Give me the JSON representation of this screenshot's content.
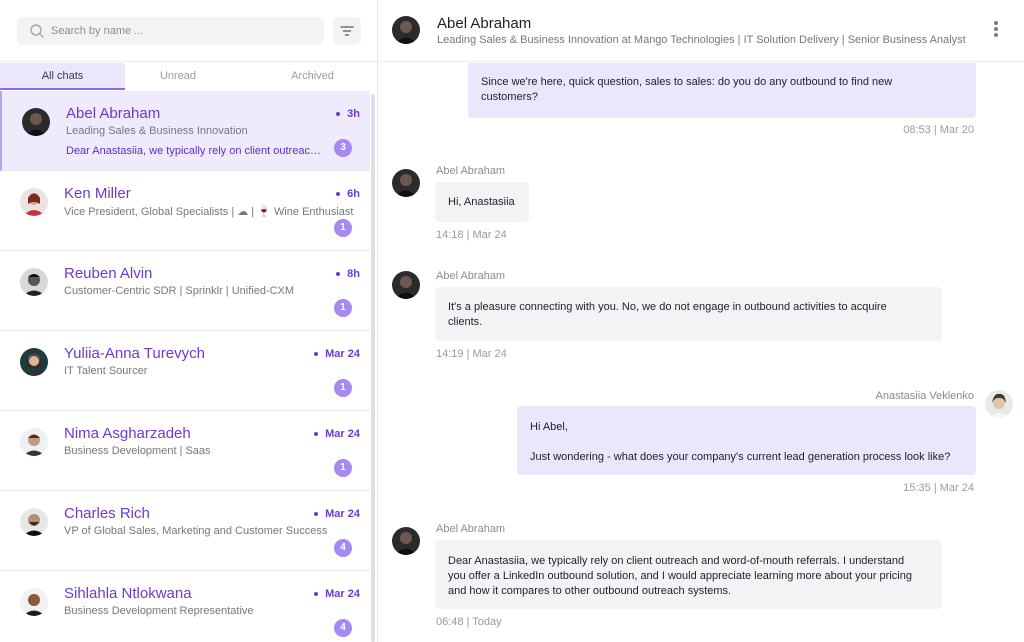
{
  "search": {
    "placeholder": "Search by name ..."
  },
  "icons": {
    "search": "search-icon",
    "filter": "filter-icon",
    "more": "more-vertical-icon"
  },
  "colors": {
    "accent": "#6a3ccc",
    "badge": "#a58af3",
    "active_bg": "#efeafc",
    "bubble_out": "#ebe6fb",
    "bubble_in": "#f3f3f6"
  },
  "tabs": [
    {
      "label": "All chats",
      "active": true
    },
    {
      "label": "Unread",
      "active": false
    },
    {
      "label": "Archived",
      "active": false
    }
  ],
  "chats": [
    {
      "name": "Abel Abraham",
      "time": "3h",
      "subtitle": "Leading Sales & Business Innovation",
      "preview": "Dear Anastasiia, we typically rely on client outreach and word-of-mouth referrals.",
      "unread": "3",
      "active": true
    },
    {
      "name": "Ken Miller",
      "time": "6h",
      "subtitle": "Vice President, Global Specialists | ☁ | 🍷 Wine Enthusiast",
      "preview": "",
      "unread": "1",
      "active": false
    },
    {
      "name": "Reuben Alvin",
      "time": "8h",
      "subtitle": "Customer-Centric SDR | Sprinklr | Unified-CXM",
      "preview": "",
      "unread": "1",
      "active": false
    },
    {
      "name": "Yuliia-Anna Turevych",
      "time": "Mar 24",
      "subtitle": "IT Talent Sourcer",
      "preview": "",
      "unread": "1",
      "active": false
    },
    {
      "name": "Nima Asgharzadeh",
      "time": "Mar 24",
      "subtitle": "Business Development | Saas",
      "preview": "",
      "unread": "1",
      "active": false
    },
    {
      "name": "Charles Rich",
      "time": "Mar 24",
      "subtitle": "VP of Global Sales, Marketing and Customer Success",
      "preview": "",
      "unread": "4",
      "active": false
    },
    {
      "name": "Sihlahla Ntlokwana",
      "time": "Mar 24",
      "subtitle": "Business Development Representative",
      "preview": "",
      "unread": "4",
      "active": false
    }
  ],
  "conversation": {
    "name": "Abel Abraham",
    "headline": "Leading Sales & Business Innovation at Mango Technologies | IT Solution Delivery | Senior Business Analyst",
    "messages": [
      {
        "direction": "out",
        "sender": "",
        "text": "Since we're here, quick question, sales to sales: do you do any outbound to find new\ncustomers?",
        "timestamp": "08:53 | Mar 20"
      },
      {
        "direction": "in",
        "sender": "Abel Abraham",
        "text": "Hi, Anastasiia",
        "timestamp": "14:18 | Mar 24"
      },
      {
        "direction": "in",
        "sender": "Abel Abraham",
        "text": "It's a pleasure connecting with you. No, we do not engage in outbound activities to acquire\nclients.",
        "timestamp": "14:19 | Mar 24"
      },
      {
        "direction": "out",
        "sender": "Anastasiia Veklenko",
        "text": "Hi Abel,\n\nJust wondering - what does your company's current lead generation process look like?",
        "timestamp": "15:35 | Mar 24"
      },
      {
        "direction": "in",
        "sender": "Abel Abraham",
        "text": "Dear Anastasiia, we typically rely on client outreach and word-of-mouth referrals. I understand\nyou offer a LinkedIn outbound solution, and I would appreciate learning more about your pricing\nand how it compares to other outbound outreach systems.",
        "timestamp": "06:48 | Today"
      }
    ]
  }
}
